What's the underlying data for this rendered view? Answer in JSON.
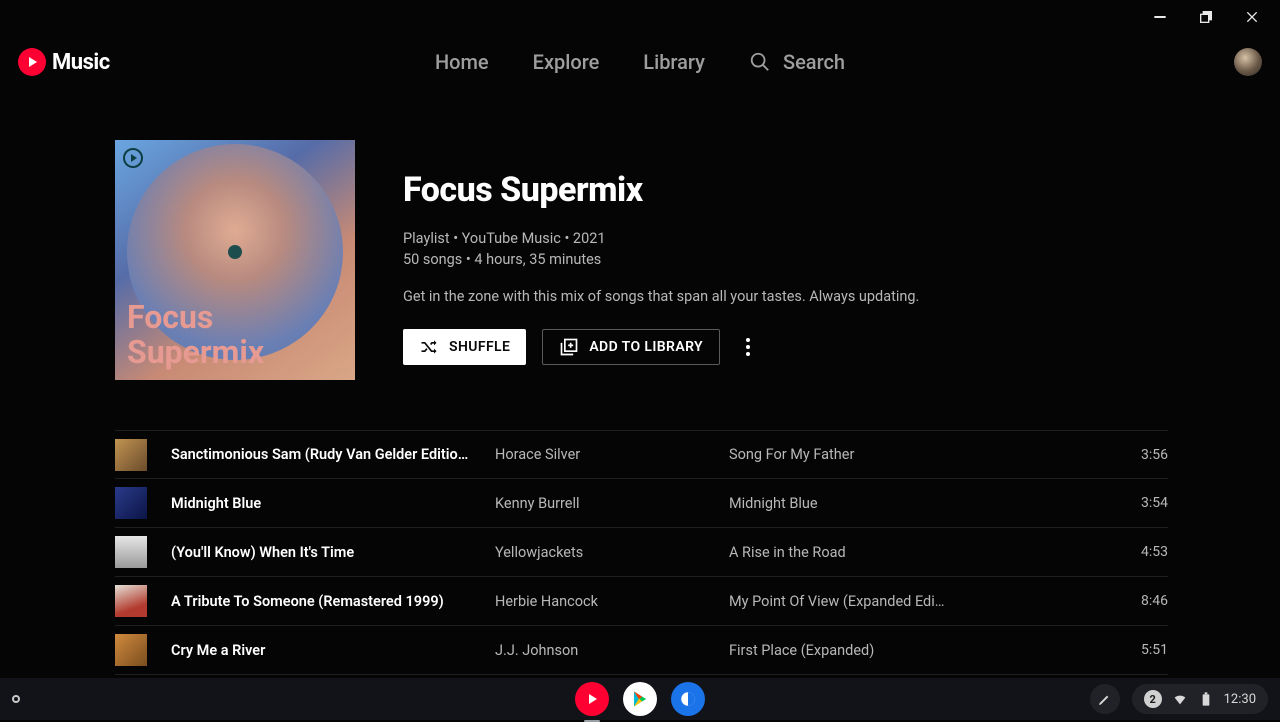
{
  "app": {
    "logo_text": "Music"
  },
  "nav": {
    "home": "Home",
    "explore": "Explore",
    "library": "Library",
    "search": "Search"
  },
  "playlist": {
    "title": "Focus Supermix",
    "meta_line1": "Playlist • YouTube Music • 2021",
    "meta_line2": "50 songs • 4 hours, 35 minutes",
    "description": "Get in the zone with this mix of songs that span all your tastes. Always updating.",
    "shuffle_label": "SHUFFLE",
    "add_label": "ADD TO LIBRARY",
    "cover_line1": "Focus",
    "cover_line2": "Supermix"
  },
  "tracks": [
    {
      "title": "Sanctimonious Sam (Rudy Van Gelder Edition/…",
      "artist": "Horace Silver",
      "album": "Song For My Father",
      "duration": "3:56",
      "thumb_bg": "linear-gradient(135deg,#c29452,#6a4b2b)"
    },
    {
      "title": "Midnight Blue",
      "artist": "Kenny Burrell",
      "album": "Midnight Blue",
      "duration": "3:54",
      "thumb_bg": "linear-gradient(135deg,#2a3a8a,#0b1547)"
    },
    {
      "title": "(You'll Know) When It's Time",
      "artist": "Yellowjackets",
      "album": "A Rise in the Road",
      "duration": "4:53",
      "thumb_bg": "linear-gradient(180deg,#e6e6e6,#9a9a9a)"
    },
    {
      "title": "A Tribute To Someone (Remastered 1999)",
      "artist": "Herbie Hancock",
      "album": "My Point Of View (Expanded Edi…",
      "duration": "8:46",
      "thumb_bg": "linear-gradient(160deg,#e4e0d6,#b33a2e 70%)"
    },
    {
      "title": "Cry Me a River",
      "artist": "J.J. Johnson",
      "album": "First Place (Expanded)",
      "duration": "5:51",
      "thumb_bg": "linear-gradient(135deg,#d08a3e,#7a4d1e)"
    }
  ],
  "taskbar": {
    "notification_count": "2",
    "time": "12:30"
  }
}
